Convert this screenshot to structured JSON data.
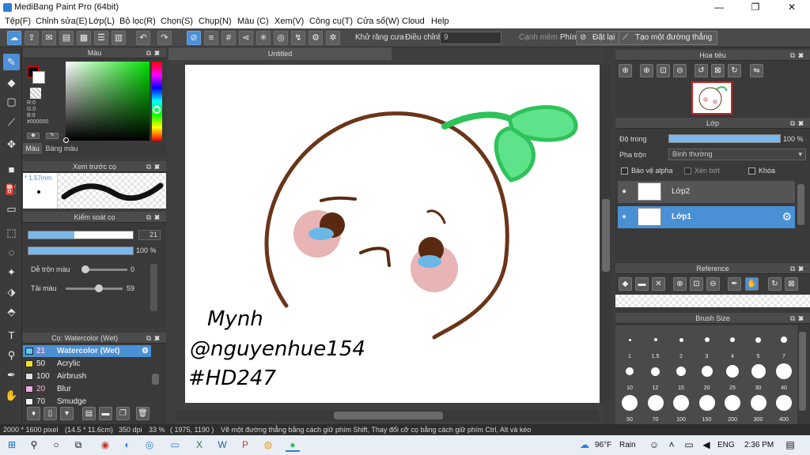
{
  "window": {
    "title": "MediBang Paint Pro (64bit)",
    "minimize": "—",
    "maximize": "❐",
    "close": "✕"
  },
  "menu": [
    "Tệp(F)",
    "Chỉnh sửa(E)",
    "Lớp(L)",
    "Bộ lọc(R)",
    "Chọn(S)",
    "Chụp(N)",
    "Màu (C)",
    "Xem(V)",
    "Công cụ(T)",
    "Cửa sổ(W)",
    "Cloud",
    "Help"
  ],
  "toolbar": {
    "antialias_label": "Khử răng cưa",
    "adjust_label": "Điều chỉnh",
    "adjust_value": "9",
    "soft_edge_label": "Cạnh mềm",
    "key_label": "Phím",
    "reset_label": "Đặt lại",
    "new_line_label": "Tạo một đường thẳng"
  },
  "color_panel": {
    "title": "Màu",
    "r": "R:0",
    "g": "G:0",
    "b": "B:0",
    "hex": "#000000",
    "tab_color": "Màu",
    "tab_palette": "Bảng màu",
    "fg_color": "#000000",
    "bg_color": "#ffffff"
  },
  "brush_preview": {
    "title": "Xem trước cọ",
    "size": "1.57mm"
  },
  "brush_control": {
    "title": "Kiểm soát cọ",
    "size_value": "21",
    "size_fraction": 0.44,
    "opacity_value": "100 %",
    "opacity_fraction": 1.0,
    "mix_label": "Dễ trộn màu",
    "mix_value": "0",
    "mix_fraction": 0.0,
    "amount_label": "Tải màu",
    "amount_value": "59",
    "amount_fraction": 0.59
  },
  "brush_list": {
    "title": "Cọ: Watercolor (Wet)",
    "items": [
      {
        "num": "21",
        "name": "Watercolor (Wet)",
        "color": "#5bc8f5",
        "active": true
      },
      {
        "num": "50",
        "name": "Acrylic",
        "color": "#f0e020",
        "active": false
      },
      {
        "num": "100",
        "name": "Airbrush",
        "color": "#e0e0e0",
        "active": false
      },
      {
        "num": "20",
        "name": "Blur",
        "color": "#f5a8e0",
        "active": false
      },
      {
        "num": "70",
        "name": "Smudge",
        "color": "#f0f0f0",
        "active": false
      }
    ]
  },
  "canvas": {
    "tab_title": "Untitled",
    "signature_lines": [
      "Mynh",
      "@nguyenhue154",
      "#HD247"
    ]
  },
  "navigator": {
    "title": "Hoa tiêu"
  },
  "layer_panel": {
    "title": "Lớp",
    "opacity_label": "Độ trong",
    "opacity_value": "100 %",
    "blend_label": "Pha trộn",
    "blend_value": "Bình thường",
    "protect_alpha": "Bảo vệ alpha",
    "clipping": "Xén bớt",
    "lock": "Khóa",
    "layers": [
      {
        "name": "Lớp2",
        "active": false
      },
      {
        "name": "Lớp1",
        "active": true
      }
    ]
  },
  "reference": {
    "title": "Reference"
  },
  "brush_size": {
    "title": "Brush Size",
    "sizes": [
      "1",
      "1.5",
      "2",
      "3",
      "4",
      "5",
      "7",
      "10",
      "12",
      "15",
      "20",
      "25",
      "30",
      "40",
      "50",
      "70",
      "100",
      "150",
      "200",
      "300",
      "400"
    ]
  },
  "status": {
    "dimensions": "2000 * 1600 pixel",
    "physical": "(14.5 * 11.6cm)",
    "dpi": "350 dpi",
    "zoom": "33 %",
    "coords": "( 1975, 1190 )",
    "hint": "Vẽ một đường thẳng bằng cách giữ phím Shift, Thay đổi cỡ cọ bằng cách giữ phím Ctrl, Alt và kéo"
  },
  "taskbar": {
    "weather_temp": "96°F",
    "weather_text": "Rain",
    "language": "ENG",
    "time": "2:36 PM"
  }
}
